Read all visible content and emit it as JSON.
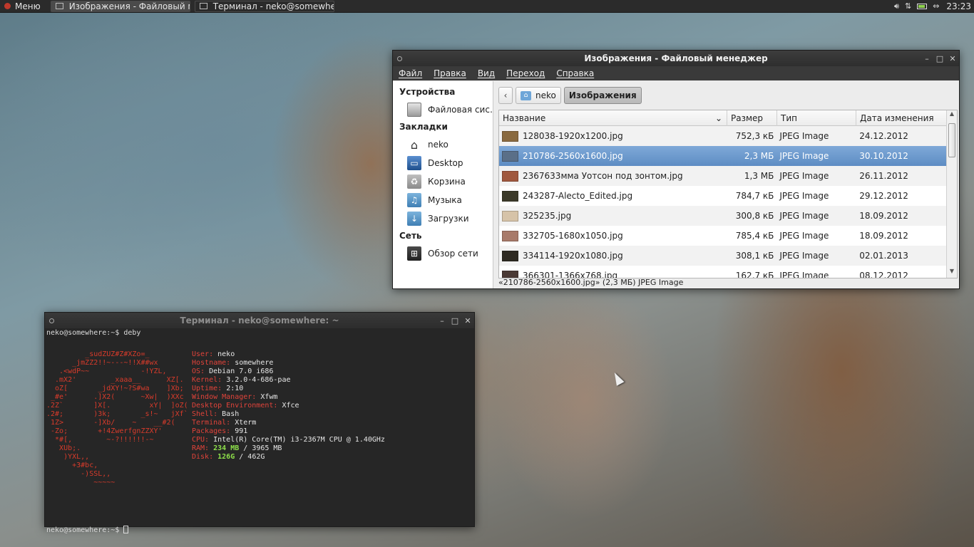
{
  "panel": {
    "menu_label": "Меню",
    "tasks": [
      {
        "label": "Изображения - Файловый мен…",
        "active": true
      },
      {
        "label": "Терминал - neko@somewhere: ~",
        "active": false
      }
    ],
    "clock": "23:23",
    "icons": [
      "volume-icon",
      "network-icon",
      "battery-icon",
      "arrows-icon"
    ]
  },
  "file_manager": {
    "title": "Изображения - Файловый менеджер",
    "menu": [
      "Файл",
      "Правка",
      "Вид",
      "Переход",
      "Справка"
    ],
    "sidebar": {
      "sections": [
        {
          "title": "Устройства",
          "items": [
            {
              "label": "Файловая сис…",
              "icon": "drive-icon"
            }
          ]
        },
        {
          "title": "Закладки",
          "items": [
            {
              "label": "neko",
              "icon": "home-icon"
            },
            {
              "label": "Desktop",
              "icon": "desktop-icon"
            },
            {
              "label": "Корзина",
              "icon": "trash-icon"
            },
            {
              "label": "Музыка",
              "icon": "music-folder-icon"
            },
            {
              "label": "Загрузки",
              "icon": "downloads-folder-icon"
            }
          ]
        },
        {
          "title": "Сеть",
          "items": [
            {
              "label": "Обзор сети",
              "icon": "network-browse-icon"
            }
          ]
        }
      ]
    },
    "pathbar": {
      "home": "neko",
      "current": "Изображения"
    },
    "columns": {
      "name": "Название",
      "size": "Размер",
      "type": "Тип",
      "date": "Дата изменения"
    },
    "files": [
      {
        "name": "128038-1920x1200.jpg",
        "size": "752,3 кБ",
        "type": "JPEG Image",
        "date": "24.12.2012",
        "thumb": "#8a6a40"
      },
      {
        "name": "210786-2560x1600.jpg",
        "size": "2,3 МБ",
        "type": "JPEG Image",
        "date": "30.10.2012",
        "thumb": "#5a6f88",
        "selected": true
      },
      {
        "name": "2367633мма Уотсон под зонтом.jpg",
        "size": "1,3 МБ",
        "type": "JPEG Image",
        "date": "26.11.2012",
        "thumb": "#a0583e"
      },
      {
        "name": "243287-Alecto_Edited.jpg",
        "size": "784,7 кБ",
        "type": "JPEG Image",
        "date": "29.12.2012",
        "thumb": "#3c3a2a"
      },
      {
        "name": "325235.jpg",
        "size": "300,8 кБ",
        "type": "JPEG Image",
        "date": "18.09.2012",
        "thumb": "#d6c3a8"
      },
      {
        "name": "332705-1680x1050.jpg",
        "size": "785,4 кБ",
        "type": "JPEG Image",
        "date": "18.09.2012",
        "thumb": "#a87a6a"
      },
      {
        "name": "334114-1920x1080.jpg",
        "size": "308,1 кБ",
        "type": "JPEG Image",
        "date": "02.01.2013",
        "thumb": "#2e2a22"
      },
      {
        "name": "366301-1366x768.jpg",
        "size": "162,7 кБ",
        "type": "JPEG Image",
        "date": "08.12.2012",
        "thumb": "#4b3a35"
      }
    ],
    "status": "«210786-2560x1600.jpg» (2,3 МБ) JPEG Image"
  },
  "terminal": {
    "title": "Терминал - neko@somewhere: ~",
    "command_line": "neko@somewhere:~$ deby",
    "logo_lines": [
      "         _sudZUZ#Z#XZo=_",
      "      _jmZZ2!!~---~!!X##wx",
      "   .<wdP~~            -!YZL,",
      "  .mX2'        _xaaa__      XZ[.",
      "  oZ[       _jdXY!~?S#wa    ]Xb;",
      " _#e'      .]X2(      ~Xw|  )XXc",
      ".2Z`       ]X[.         xY|  ]oZ(",
      ".2#;       )3k;       _s!~   jXf`",
      " 1Z>       -]Xb/    ~    __#2(",
      " -Zo;       +!4ZwerfgnZZXY'",
      "  *#[,        ~-?!!!!!!-~",
      "   XUb;.",
      "    )YXL,,",
      "      +3#bc,",
      "        -)SSL,,",
      "           ~~~~~"
    ],
    "info": [
      {
        "key": "User:",
        "value": "neko"
      },
      {
        "key": "Hostname:",
        "value": "somewhere"
      },
      {
        "key": "OS:",
        "value": "Debian 7.0 i686"
      },
      {
        "key": "Kernel:",
        "value": "3.2.0-4-686-pae"
      },
      {
        "key": "Uptime:",
        "value": "2:10"
      },
      {
        "key": "Window Manager:",
        "value": "Xfwm"
      },
      {
        "key": "Desktop Environment:",
        "value": "Xfce"
      },
      {
        "key": "Shell:",
        "value": "Bash"
      },
      {
        "key": "Terminal:",
        "value": "Xterm"
      },
      {
        "key": "Packages:",
        "value": "991"
      },
      {
        "key": "CPU:",
        "value": "Intel(R) Core(TM) i3-2367M CPU @ 1.40GHz"
      }
    ],
    "ram": {
      "key": "RAM:",
      "used": "234 MB",
      "sep": " / ",
      "total": "3965 MB"
    },
    "disk": {
      "key": "Disk:",
      "used": "126G",
      "sep": " / ",
      "total": "462G"
    },
    "prompt": "neko@somewhere:~$ "
  }
}
